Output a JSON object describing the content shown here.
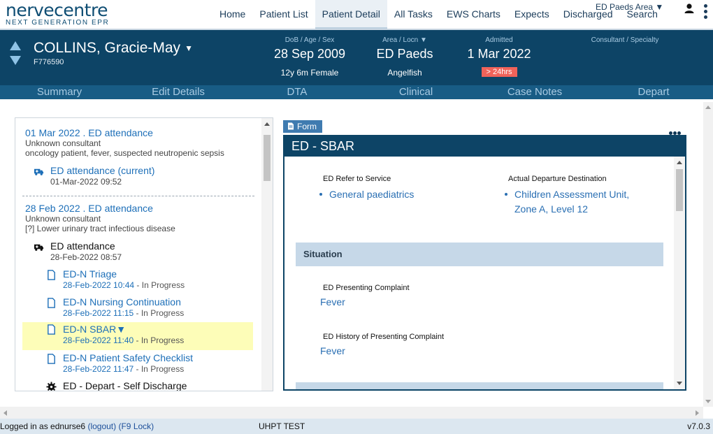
{
  "app": {
    "logo_name": "nervecentre",
    "logo_tagline": "NEXT GENERATION EPR"
  },
  "nav": {
    "items": [
      "Home",
      "Patient List",
      "Patient Detail",
      "All Tasks",
      "EWS Charts",
      "Expects",
      "Discharged",
      "Search"
    ],
    "active": "Patient Detail",
    "area_select": "ED Paeds Area ▼"
  },
  "patient": {
    "name": "COLLINS, Gracie-May",
    "name_dropdown": "▼",
    "id": "F776590",
    "dob_label": "DoB / Age / Sex",
    "dob": "28 Sep 2009",
    "age_sex": "12y 6m Female",
    "area_label": "Area / Locn  ▼",
    "area": "ED Paeds",
    "location": "Angelfish",
    "admitted_label": "Admitted",
    "admitted": "1 Mar 2022",
    "los_badge": "> 24hrs",
    "consultant_label": "Consultant / Specialty"
  },
  "tabs": [
    "Summary",
    "Edit Details",
    "DTA",
    "Clinical",
    "Case Notes",
    "Depart"
  ],
  "timeline": {
    "attendance1": {
      "title": "01 Mar 2022 . ED attendance",
      "consultant": "Unknown consultant",
      "reason": "oncology patient, fever, suspected neutropenic sepsis",
      "item": {
        "name": "ED attendance (current)",
        "date": "01-Mar-2022 09:52"
      }
    },
    "attendance2": {
      "title": "28 Feb 2022 . ED attendance",
      "consultant": "Unknown consultant",
      "reason": "[?] Lower urinary tract infectious disease",
      "items": [
        {
          "name": "ED attendance",
          "date": "28-Feb-2022 08:57",
          "status": ""
        },
        {
          "name": "ED-N Triage",
          "date": "28-Feb-2022 10:44",
          "status": " - In Progress"
        },
        {
          "name": "ED-N Nursing Continuation",
          "date": "28-Feb-2022 11:15",
          "status": " - In Progress"
        },
        {
          "name": "ED-N SBAR▼",
          "date": "28-Feb-2022 11:40",
          "status": " - In Progress"
        },
        {
          "name": "ED-N Patient Safety Checklist",
          "date": "28-Feb-2022 11:47",
          "status": " - In Progress"
        },
        {
          "name": "ED - Depart - Self Discharge",
          "date": "",
          "status": ""
        }
      ]
    }
  },
  "form": {
    "tag": "Form",
    "title": "ED - SBAR",
    "refer_label": "ED Refer to Service",
    "refer_value": "General paediatrics",
    "departure_label": "Actual Departure Destination",
    "departure_value_line1": "Children Assessment Unit,",
    "departure_value_line2": "Zone A, Level 12",
    "section_situation": "Situation",
    "complaint_label": "ED Presenting Complaint",
    "complaint_value": "Fever",
    "history_label": "ED History of Presenting Complaint",
    "history_value": "Fever"
  },
  "status_bar": {
    "logged_in": "Logged in as ednurse6",
    "logout": "(logout)",
    "lock": "(F9 Lock)",
    "environment": "UHPT TEST",
    "version": "v7.0.3"
  },
  "colors": {
    "banner": "#0d4466",
    "tab_bar": "#185c85",
    "link": "#1d6fb8",
    "los_badge": "#f0635a",
    "selected_row": "#fdfdb8",
    "section_header": "#c6d8e8"
  },
  "icons": {
    "ambulance": "ambulance-icon",
    "document": "document-icon",
    "depart": "gear-icon",
    "user": "user-icon",
    "menu": "kebab-menu-icon"
  }
}
